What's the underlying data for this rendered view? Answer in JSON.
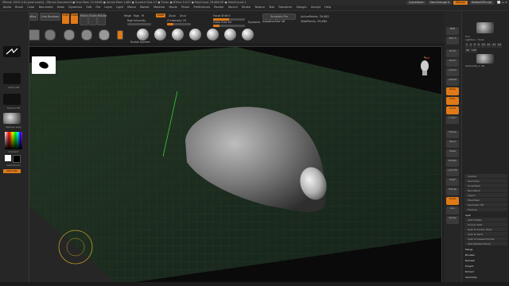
{
  "titlebar": {
    "title": "ZBrush 2022.0.6 [pixol exold] - ZBrush Document  ● Free Mem 10.58GB ● Active Mem 1485 ● Scratch Disk 17 ● Timer ● RTime 0.017 ● PolyCount 78.868 KP ● MeshCount 1",
    "quicksave": "QuickSave",
    "seethrough": "See-through 0",
    "menus_label": "Menus",
    "default_script": "DefaultZScript"
  },
  "menubar": {
    "items": [
      "Alpha",
      "Brush",
      "Color",
      "Document",
      "Draw",
      "Dynamics",
      "Edit",
      "File",
      "Layer",
      "Light",
      "Macro",
      "Marker",
      "Material",
      "Movie",
      "Picker",
      "Preferences",
      "Render",
      "Stencil",
      "Stroke",
      "Texture",
      "Tool",
      "Transform",
      "Zplugin",
      "Zscript",
      "Help"
    ]
  },
  "toolbar": {
    "home_page": "Home Page",
    "lightbox": "LightBox",
    "live_boolean": "Live Boolean",
    "edit": "Edit",
    "draw": "Draw",
    "move": "Move",
    "scale": "Scale",
    "rotate": "Rotate",
    "mrgb": "Mrgb",
    "rgb": "Rgb",
    "m": "M",
    "zadd": "Zadd",
    "zsub": "Zsub",
    "zcut": "Zcut",
    "rgb_intensity": "Rgb Intensity",
    "z_intensity": "Z Intensity 25",
    "focal_shift": "Focal Shift 0",
    "draw_size": "Draw Size 64",
    "dynamic": "Dynamic",
    "active_points": "ActivePoints: 39,682",
    "total_points": "TotalPoints: 39,682",
    "sculptris": "Sculptris Pro",
    "adaptive_size": "AdaptiveSize 48",
    "brush_name": "Sculpt Sphere"
  },
  "left_shelf": {
    "alpha_label": "Alpha Off",
    "texture_label": "Texture Off",
    "material_label": "MatCap Gray",
    "gradient": "Gradient",
    "switch_color": "SwitchColor",
    "alternate": "Alternate"
  },
  "right_tray": {
    "tool_title": "Tool",
    "lightbox_tools": "Lightbox › Tools",
    "tool_name": "Sphere3D_1. 48",
    "subtool_items": [
      "Subtool",
      "Geometry",
      "ArrayMesh",
      "NanoMesh",
      "Layers",
      "FiberMesh",
      "Geometry HD",
      "Preview",
      "Surface",
      "Deformation",
      "Masking",
      "Visibility",
      "Polygroups",
      "Contact",
      "Morph Target",
      "Polypaint",
      "UV Map",
      "Texture Map",
      "Displacement Map",
      "Normal Map",
      "Vector Displacement Map",
      "Display Properties",
      "Unified Skin",
      "Initialize",
      "Import",
      "Export"
    ],
    "split_items": [
      "Split",
      "Split Hidden",
      "Groups Split",
      "Split To Similar Parts",
      "Split To Parts",
      "Split Unmasked Points",
      "Split Masked Points",
      "Merge",
      "Boolean",
      "Remesh",
      "Project",
      "Extract"
    ],
    "numbers": [
      "1",
      "4",
      "6",
      "8",
      "16",
      "24",
      "32",
      "64",
      "96",
      "128"
    ]
  },
  "right_shelf": {
    "labels": [
      "BPR",
      "SPix 3",
      "Scroll",
      "Zoom",
      "Actual",
      "AAHalf",
      "Persp",
      "Floor",
      "Local",
      "L.Sym",
      "Frame",
      "Move",
      "Scale",
      "Rotate",
      "Line Fill",
      "PolyF",
      "Transp",
      "Ghost",
      "Solo",
      "Xpose"
    ]
  },
  "colors": {
    "accent": "#e07a18",
    "floor_grid": "#1c2a1c",
    "model": "#8a8a8a"
  }
}
